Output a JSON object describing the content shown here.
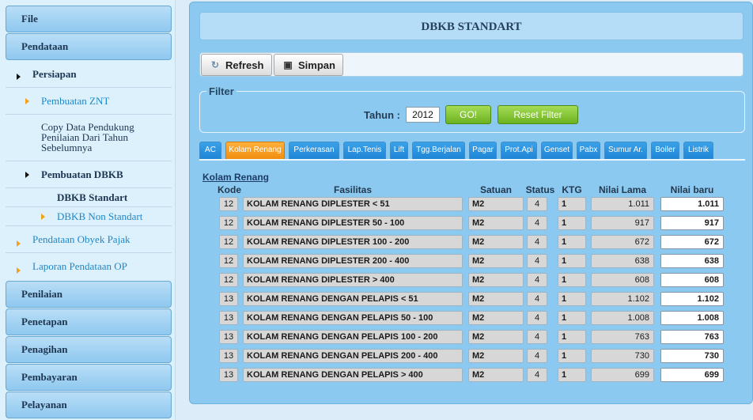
{
  "sidebar": {
    "file": "File",
    "pendataan": "Pendataan",
    "persiapan": "Persiapan",
    "pembuatan_znt": "Pembuatan ZNT",
    "copy_data": "Copy Data Pendukung Penilaian Dari Tahun Sebelumnya",
    "pembuatan_dbkb": "Pembuatan DBKB",
    "dbkb_standart": "DBKB Standart",
    "dbkb_non_standart": "DBKB Non Standart",
    "pendataan_op": "Pendataan Obyek Pajak",
    "laporan_op": "Laporan Pendataan OP",
    "penilaian": "Penilaian",
    "penetapan": "Penetapan",
    "penagihan": "Penagihan",
    "pembayaran": "Pembayaran",
    "pelayanan": "Pelayanan"
  },
  "main": {
    "title": "DBKB STANDART",
    "refresh": "Refresh",
    "simpan": "Simpan",
    "filter_label": "Filter",
    "tahun_label": "Tahun :",
    "tahun_value": "2012",
    "go": "GO!",
    "reset": "Reset Filter"
  },
  "tabs": [
    "AC",
    "Kolam Renang",
    "Perkerasan",
    "Lap.Tenis",
    "Lift",
    "Tgg.Berjalan",
    "Pagar",
    "Prot.Api",
    "Genset",
    "Pabx",
    "Sumur Ar.",
    "Boiler",
    "Listrik"
  ],
  "active_tab": "Kolam Renang",
  "table": {
    "section": "Kolam Renang",
    "headers": {
      "kode": "Kode",
      "fasilitas": "Fasilitas",
      "satuan": "Satuan",
      "status": "Status",
      "ktg": "KTG",
      "nilai_lama": "Nilai Lama",
      "nilai_baru": "Nilai baru"
    },
    "rows": [
      {
        "kode": "12",
        "fasilitas": "KOLAM RENANG DIPLESTER < 51",
        "satuan": "M2",
        "status": "4",
        "ktg": "1",
        "nilai_lama": "1.011",
        "nilai_baru": "1.011"
      },
      {
        "kode": "12",
        "fasilitas": "KOLAM RENANG DIPLESTER 50 - 100",
        "satuan": "M2",
        "status": "4",
        "ktg": "1",
        "nilai_lama": "917",
        "nilai_baru": "917"
      },
      {
        "kode": "12",
        "fasilitas": "KOLAM RENANG DIPLESTER 100 - 200",
        "satuan": "M2",
        "status": "4",
        "ktg": "1",
        "nilai_lama": "672",
        "nilai_baru": "672"
      },
      {
        "kode": "12",
        "fasilitas": "KOLAM RENANG DIPLESTER 200 - 400",
        "satuan": "M2",
        "status": "4",
        "ktg": "1",
        "nilai_lama": "638",
        "nilai_baru": "638"
      },
      {
        "kode": "12",
        "fasilitas": "KOLAM RENANG DIPLESTER > 400",
        "satuan": "M2",
        "status": "4",
        "ktg": "1",
        "nilai_lama": "608",
        "nilai_baru": "608"
      },
      {
        "kode": "13",
        "fasilitas": "KOLAM RENANG DENGAN PELAPIS < 51",
        "satuan": "M2",
        "status": "4",
        "ktg": "1",
        "nilai_lama": "1.102",
        "nilai_baru": "1.102"
      },
      {
        "kode": "13",
        "fasilitas": "KOLAM RENANG DENGAN PELAPIS 50 - 100",
        "satuan": "M2",
        "status": "4",
        "ktg": "1",
        "nilai_lama": "1.008",
        "nilai_baru": "1.008"
      },
      {
        "kode": "13",
        "fasilitas": "KOLAM RENANG DENGAN PELAPIS 100 - 200",
        "satuan": "M2",
        "status": "4",
        "ktg": "1",
        "nilai_lama": "763",
        "nilai_baru": "763"
      },
      {
        "kode": "13",
        "fasilitas": "KOLAM RENANG DENGAN PELAPIS 200 - 400",
        "satuan": "M2",
        "status": "4",
        "ktg": "1",
        "nilai_lama": "730",
        "nilai_baru": "730"
      },
      {
        "kode": "13",
        "fasilitas": "KOLAM RENANG DENGAN PELAPIS > 400",
        "satuan": "M2",
        "status": "4",
        "ktg": "1",
        "nilai_lama": "699",
        "nilai_baru": "699"
      }
    ]
  }
}
